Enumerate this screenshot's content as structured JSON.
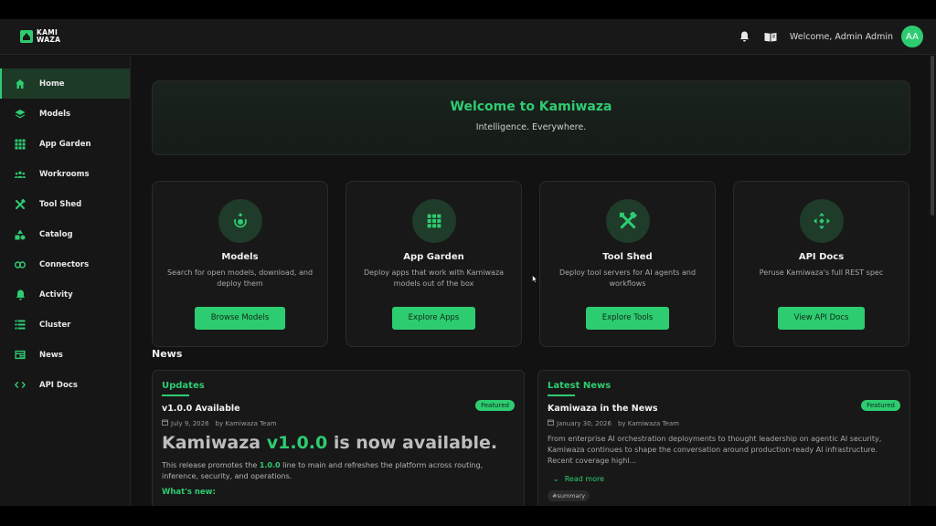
{
  "app": {
    "logo_line1": "KAMI",
    "logo_line2": "WAZA",
    "welcome": "Welcome, Admin Admin",
    "avatar_initials": "AA"
  },
  "colors": {
    "accent": "#2ecc71",
    "background": "#121212",
    "card": "#181818"
  },
  "sidebar": {
    "items": [
      {
        "label": "Home",
        "icon": "home-icon",
        "active": true
      },
      {
        "label": "Models",
        "icon": "layers-icon"
      },
      {
        "label": "App Garden",
        "icon": "grid-icon"
      },
      {
        "label": "Workrooms",
        "icon": "users-icon"
      },
      {
        "label": "Tool Shed",
        "icon": "tools-icon"
      },
      {
        "label": "Catalog",
        "icon": "shapes-icon"
      },
      {
        "label": "Connectors",
        "icon": "link-icon"
      },
      {
        "label": "Activity",
        "icon": "bell-icon"
      },
      {
        "label": "Cluster",
        "icon": "list-icon"
      },
      {
        "label": "News",
        "icon": "newspaper-icon"
      },
      {
        "label": "API Docs",
        "icon": "code-icon"
      }
    ]
  },
  "hero": {
    "title": "Welcome to Kamiwaza",
    "subtitle": "Intelligence. Everywhere."
  },
  "cards": [
    {
      "title": "Models",
      "desc": "Search for open models, download, and deploy them",
      "button": "Browse Models",
      "icon": "model-icon"
    },
    {
      "title": "App Garden",
      "desc": "Deploy apps that work with Kamiwaza models out of the box",
      "button": "Explore Apps",
      "icon": "grid-icon"
    },
    {
      "title": "Tool Shed",
      "desc": "Deploy tool servers for AI agents and workflows",
      "button": "Explore Tools",
      "icon": "tools-icon"
    },
    {
      "title": "API Docs",
      "desc": "Peruse Kamiwaza's full REST spec",
      "button": "View API Docs",
      "icon": "api-icon"
    }
  ],
  "news": {
    "section_title": "News",
    "updates": {
      "heading": "Updates",
      "item_title": "v1.0.0 Available",
      "badge": "Featured",
      "date": "July 9, 2026",
      "author": "by Kamiwaza Team",
      "headline_pre": "Kamiwaza ",
      "headline_ver": "v1.0.0",
      "headline_post": " is now available.",
      "body_pre": "This release promotes the ",
      "body_ver": "1.0.0",
      "body_post": " line to main and refreshes the platform across routing, inference, security, and operations.",
      "whats_new": "What's new:"
    },
    "latest": {
      "heading": "Latest News",
      "item_title": "Kamiwaza in the News",
      "badge": "Featured",
      "date": "January 30, 2026",
      "author": "by Kamiwaza Team",
      "body": "From enterprise AI orchestration deployments to thought leadership on agentic AI security, Kamiwaza continues to shape the conversation around production-ready AI infrastructure. Recent coverage highl...",
      "read_more": "Read more",
      "tag": "#summary"
    }
  }
}
